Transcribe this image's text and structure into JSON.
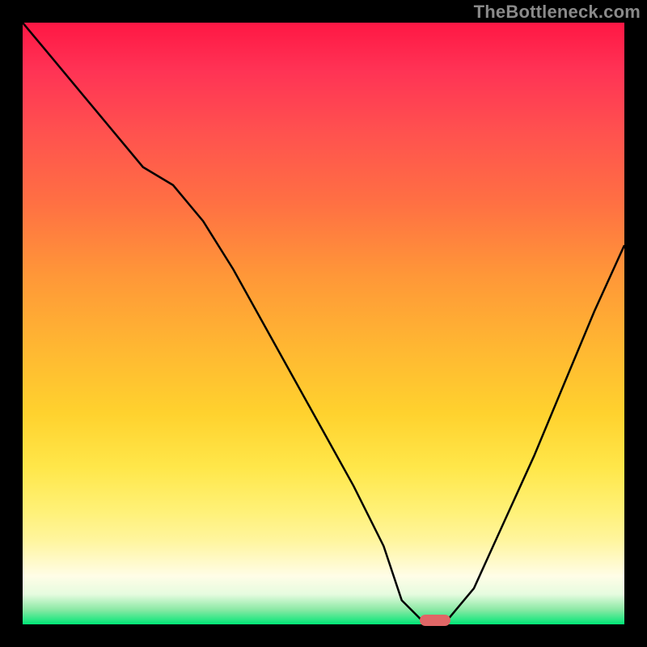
{
  "watermark": "TheBottleneck.com",
  "colors": {
    "frame": "#000000",
    "gradient_top": "#ff1744",
    "gradient_mid": "#ffd22e",
    "gradient_bottom": "#00e676",
    "curve": "#000000",
    "marker": "#e06666"
  },
  "chart_data": {
    "type": "line",
    "title": "",
    "xlabel": "",
    "ylabel": "",
    "xlim": [
      0,
      100
    ],
    "ylim": [
      0,
      100
    ],
    "grid": false,
    "x": [
      0,
      5,
      10,
      15,
      20,
      25,
      30,
      35,
      40,
      45,
      50,
      55,
      60,
      63,
      67,
      70,
      75,
      80,
      85,
      90,
      95,
      100
    ],
    "values": [
      100,
      94,
      88,
      82,
      76,
      73,
      67,
      59,
      50,
      41,
      32,
      23,
      13,
      4,
      0,
      0,
      6,
      17,
      28,
      40,
      52,
      63
    ],
    "marker_x": 68.5,
    "marker_y": 0,
    "legend": false
  }
}
